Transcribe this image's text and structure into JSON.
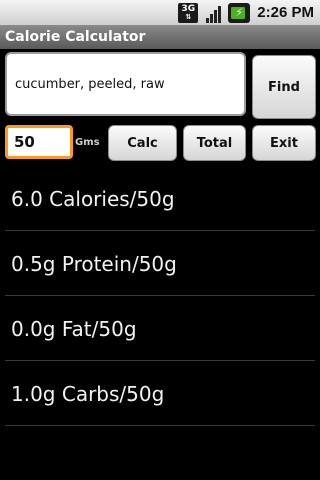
{
  "status_bar": {
    "network_type": "3G",
    "clock": "2:26 PM",
    "network_icon": "3g-data-icon",
    "signal_icon": "signal-strength-icon",
    "battery_icon": "battery-charging-icon"
  },
  "title_bar": {
    "title": "Calorie Calculator"
  },
  "search": {
    "value": "cucumber, peeled, raw",
    "find_label": "Find"
  },
  "controls": {
    "quantity_value": "50",
    "unit_label": "Gms",
    "calc_label": "Calc",
    "total_label": "Total",
    "exit_label": "Exit"
  },
  "results": [
    {
      "text": "6.0 Calories/50g"
    },
    {
      "text": "0.5g Protein/50g"
    },
    {
      "text": "0.0g Fat/50g"
    },
    {
      "text": "1.0g Carbs/50g"
    }
  ],
  "colors": {
    "background": "#000000",
    "focus_border": "#ff9a18",
    "battery_fill": "#4caf1e"
  }
}
